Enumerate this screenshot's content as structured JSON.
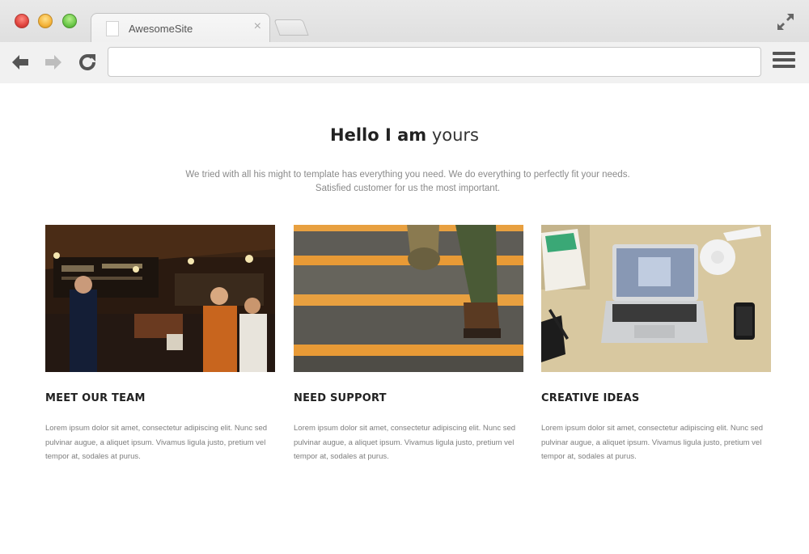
{
  "browser": {
    "tab_title": "AwesomeSite",
    "tab_close": "×",
    "address_value": ""
  },
  "hero": {
    "title_bold": "Hello I am",
    "title_light": "yours",
    "description_line1": "We tried with all his might to template has everything you need. We do everything to perfectly fit your needs.",
    "description_line2": "Satisfied customer for us the most important."
  },
  "cards": [
    {
      "title": "MEET OUR TEAM",
      "image": "cafe-crowd-photo",
      "text": "Lorem ipsum dolor sit amet, consectetur adipiscing elit. Nunc sed pulvinar augue, a aliquet ipsum. Vivamus ligula justo, pretium vel tempor at, sodales at purus."
    },
    {
      "title": "NEED SUPPORT",
      "image": "stairs-walking-photo",
      "text": "Lorem ipsum dolor sit amet, consectetur adipiscing elit. Nunc sed pulvinar augue, a aliquet ipsum. Vivamus ligula justo, pretium vel tempor at, sodales at purus."
    },
    {
      "title": "CREATIVE IDEAS",
      "image": "laptop-desk-photo",
      "text": "Lorem ipsum dolor sit amet, consectetur adipiscing elit. Nunc sed pulvinar augue, a aliquet ipsum. Vivamus ligula justo, pretium vel tempor at, sodales at purus."
    }
  ],
  "colors": {
    "chrome_bg": "#dcdcdc",
    "title_text": "#222222",
    "muted_text": "#8a8a8a",
    "stair_orange": "#e8a040"
  }
}
